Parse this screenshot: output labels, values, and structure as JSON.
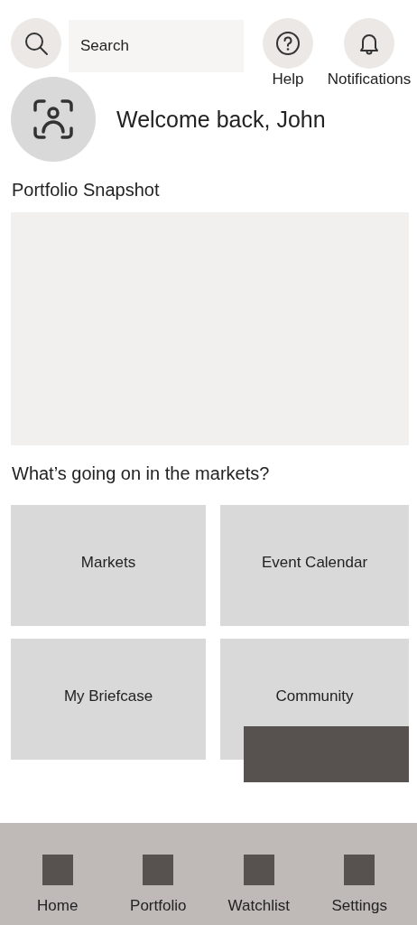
{
  "search": {
    "placeholder": "Search"
  },
  "header_actions": [
    {
      "kind": "help",
      "label": "Help"
    },
    {
      "kind": "notifications",
      "label": "Notifications"
    }
  ],
  "greeting": "Welcome back, John",
  "portfolio": {
    "title": "Portfolio Snapshot"
  },
  "markets": {
    "title": "What’s going on in the markets?",
    "tiles": [
      "Markets",
      "Event Calendar",
      "My Briefcase",
      "Community"
    ]
  },
  "bottom_nav": [
    "Home",
    "Portfolio",
    "Watchlist",
    "Settings"
  ]
}
